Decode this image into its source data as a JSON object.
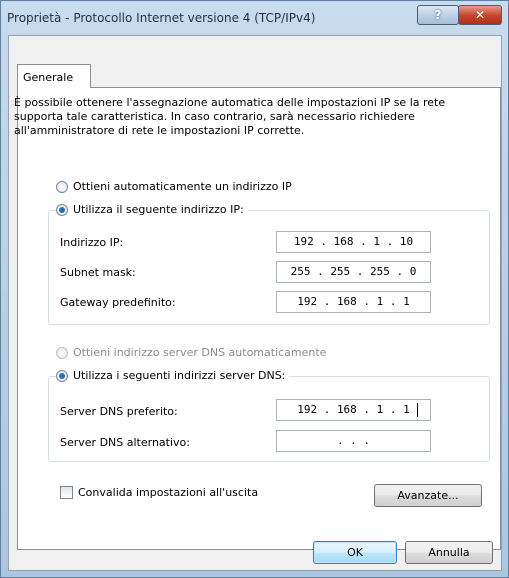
{
  "window": {
    "title": "Proprietà - Protocollo Internet versione 4 (TCP/IPv4)",
    "help_label": "?",
    "close_label": "✕"
  },
  "tabs": [
    {
      "label": "Generale"
    }
  ],
  "description": "È possibile ottenere l'assegnazione automatica delle impostazioni IP se la rete supporta tale caratteristica. In caso contrario, sarà necessario richiedere all'amministratore di rete le impostazioni IP corrette.",
  "ip": {
    "auto_label": "Ottieni automaticamente un indirizzo IP",
    "manual_label": "Utilizza il seguente indirizzo IP:",
    "selected": "manual",
    "fields": [
      {
        "label": "Indirizzo IP:",
        "value": "192 . 168 .  1  . 10"
      },
      {
        "label": "Subnet mask:",
        "value": "255 . 255 . 255 .  0"
      },
      {
        "label": "Gateway predefinito:",
        "value": "192 . 168 .  1  .  1"
      }
    ]
  },
  "dns": {
    "auto_label": "Ottieni indirizzo server DNS automaticamente",
    "manual_label": "Utilizza i seguenti indirizzi server DNS:",
    "selected": "manual",
    "fields": [
      {
        "label": "Server DNS preferito:",
        "value": "192 . 168 .  1  .  1"
      },
      {
        "label": "Server DNS alternativo:",
        "value": "  .      .      .  "
      }
    ]
  },
  "validate_label": "Convalida impostazioni all'uscita",
  "validate_checked": false,
  "advanced_label": "Avanzate...",
  "ok_label": "OK",
  "cancel_label": "Annulla"
}
